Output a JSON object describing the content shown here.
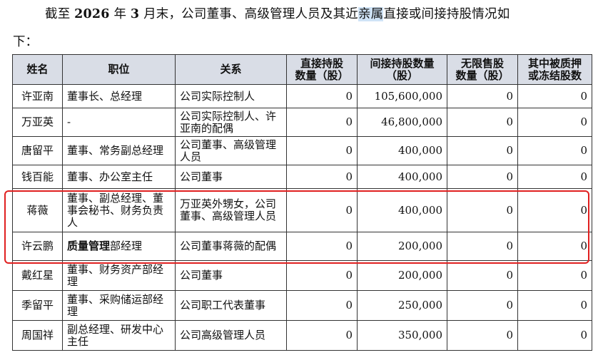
{
  "intro": {
    "seg1": "截至 ",
    "year": "2026",
    "seg2": " 年 ",
    "month": "3",
    "seg3": " 月末",
    "seg4": "，公司董事、高级管理人员及其近",
    "highlight": "亲属",
    "seg5": "直接或间接持股情况如",
    "line2": "下："
  },
  "table": {
    "headers": {
      "name": "姓名",
      "position": "职位",
      "relation": "关系",
      "direct_1": "直接持股",
      "direct_2": "数量（股）",
      "indirect_1": "间接持股数量",
      "indirect_2": "（股）",
      "unrestricted_1": "无限售股",
      "unrestricted_2": "数量（股）",
      "pledged_1": "其中被质押",
      "pledged_2": "或冻结股数"
    },
    "rows": [
      {
        "name": "许亚南",
        "position": "董事长、总经理",
        "relation": "公司实际控制人",
        "direct": "0",
        "indirect": "105,600,000",
        "unrestricted": "0",
        "pledged": "0"
      },
      {
        "name": "万亚英",
        "position": "-",
        "relation": "公司实际控制人、许亚南的配偶",
        "direct": "0",
        "indirect": "46,800,000",
        "unrestricted": "0",
        "pledged": "0"
      },
      {
        "name": "唐留平",
        "position": "董事、常务副总经理",
        "relation": "公司董事、高级管理人员",
        "direct": "0",
        "indirect": "400,000",
        "unrestricted": "0",
        "pledged": "0"
      },
      {
        "name": "钱百能",
        "position": "董事、办公室主任",
        "relation": "公司董事",
        "direct": "0",
        "indirect": "400,000",
        "unrestricted": "0",
        "pledged": "0"
      },
      {
        "name": "蒋薇",
        "position": "董事、副总经理、董事会秘书、财务负责人",
        "relation": "万亚英外甥女，公司董事、高级管理人员",
        "direct": "0",
        "indirect": "400,000",
        "unrestricted": "0",
        "pledged": "0"
      },
      {
        "name": "许云鹏",
        "position_bold": "质量管理",
        "position_rest": "部经理",
        "relation": "公司董事蒋薇的配偶",
        "direct": "0",
        "indirect": "200,000",
        "unrestricted": "0",
        "pledged": "0"
      },
      {
        "name": "戴红星",
        "position": "董事、财务资产部经理",
        "relation": "公司董事",
        "direct": "0",
        "indirect": "200,000",
        "unrestricted": "0",
        "pledged": "0"
      },
      {
        "name": "季留平",
        "position": "董事、采购储运部经理",
        "relation": "公司职工代表董事",
        "direct": "0",
        "indirect": "250,000",
        "unrestricted": "0",
        "pledged": "0"
      },
      {
        "name": "周国祥",
        "position": "副总经理、研发中心主任",
        "relation": "公司高级管理人员",
        "direct": "0",
        "indirect": "350,000",
        "unrestricted": "0",
        "pledged": "0"
      }
    ]
  },
  "colors": {
    "header_bg": "#d9dde6",
    "highlight_bg": "#cfe3f6",
    "annotation_border": "#e02020"
  }
}
